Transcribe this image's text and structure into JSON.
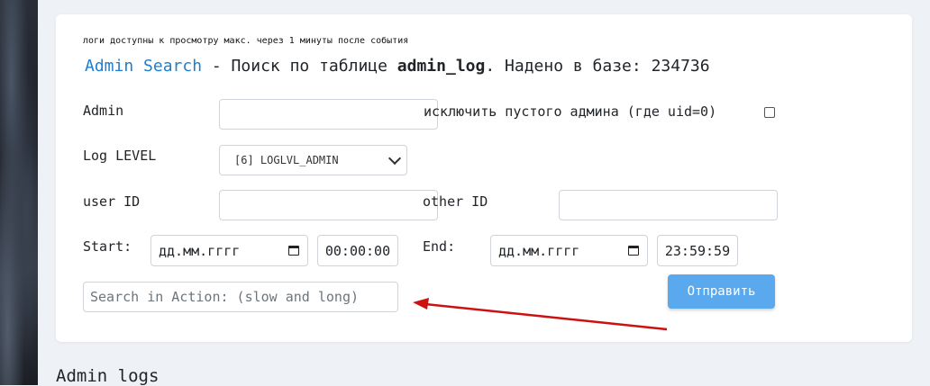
{
  "note": "логи доступны к просмотру макс. через 1 минуты после события",
  "heading": {
    "link": "Admin Search",
    "dash": " - Поиск по таблице ",
    "table": "admin_log",
    "suffix": ". Надено в базе: 234736"
  },
  "form": {
    "admin_label": "Admin",
    "exclude_label": "исключить пустого админа (где uid=0)",
    "exclude_checked": false,
    "loglevel_label": "Log LEVEL",
    "loglevel_value": "[6] LOGLVL_ADMIN",
    "userid_label": "user ID",
    "otherid_label": "other ID",
    "start_label": "Start:",
    "start_date_placeholder": "дд.мм.гггг",
    "start_time": "00:00:00",
    "end_label": "End:",
    "end_date_placeholder": "дд.мм.гггг",
    "end_time": "23:59:59",
    "search_placeholder": "Search in Action: (slow and long)",
    "submit_label": "Отправить"
  },
  "section_title": "Admin logs",
  "colors": {
    "link": "#1c7fd1",
    "button": "#5aa9ee",
    "arrow": "#cc1111"
  }
}
